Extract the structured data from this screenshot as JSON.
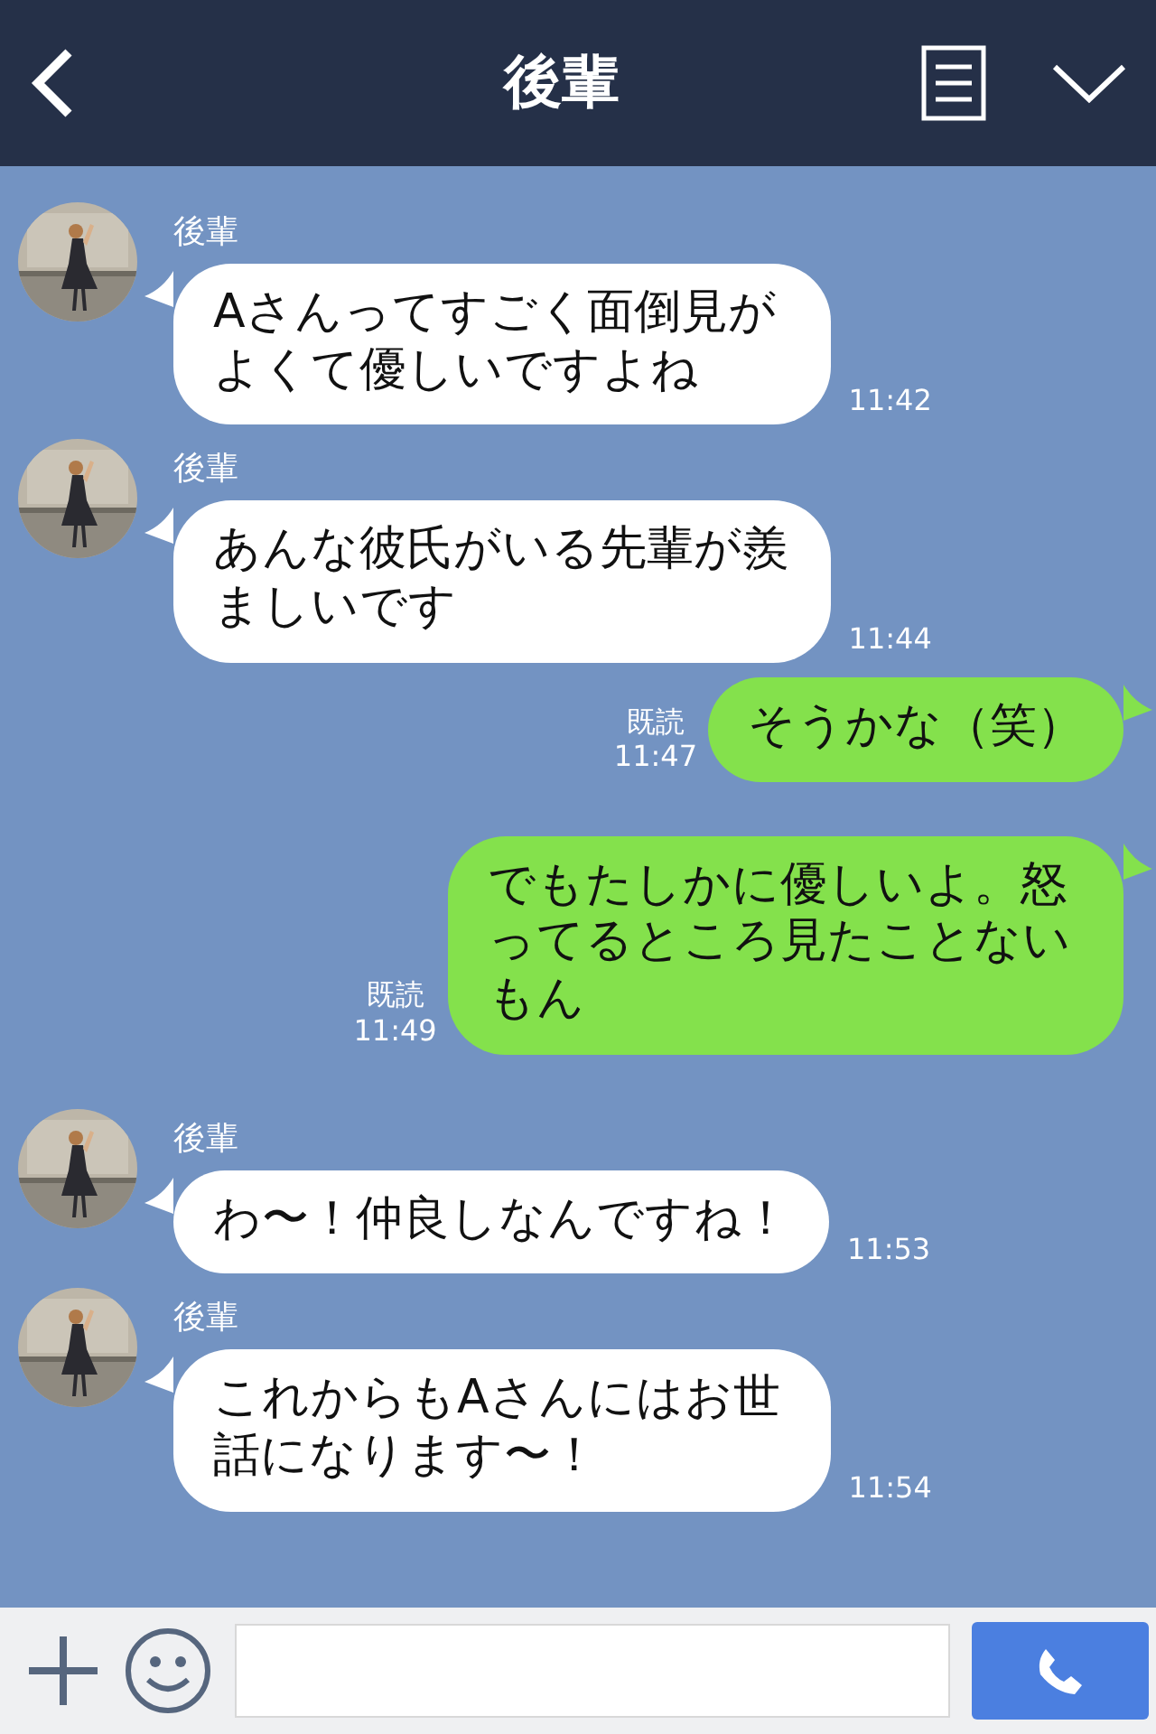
{
  "header": {
    "title": "後輩"
  },
  "messages": [
    {
      "kind": "incoming",
      "sender": "後輩",
      "text": "Aさんってすごく面倒見がよくて優しいですよね",
      "time": "11:42"
    },
    {
      "kind": "incoming",
      "sender": "後輩",
      "text": "あんな彼氏がいる先輩が羨ましいです",
      "time": "11:44"
    },
    {
      "kind": "outgoing",
      "read": "既読",
      "text": "そうかな（笑）",
      "time": "11:47"
    },
    {
      "kind": "outgoing",
      "read": "既読",
      "text": "でもたしかに優しいよ。怒ってるところ見たことないもん",
      "time": "11:49"
    },
    {
      "kind": "incoming",
      "sender": "後輩",
      "text": "わ〜！仲良しなんですね！",
      "time": "11:53"
    },
    {
      "kind": "incoming",
      "sender": "後輩",
      "text": "これからもAさんにはお世話になります〜！",
      "time": "11:54"
    }
  ]
}
